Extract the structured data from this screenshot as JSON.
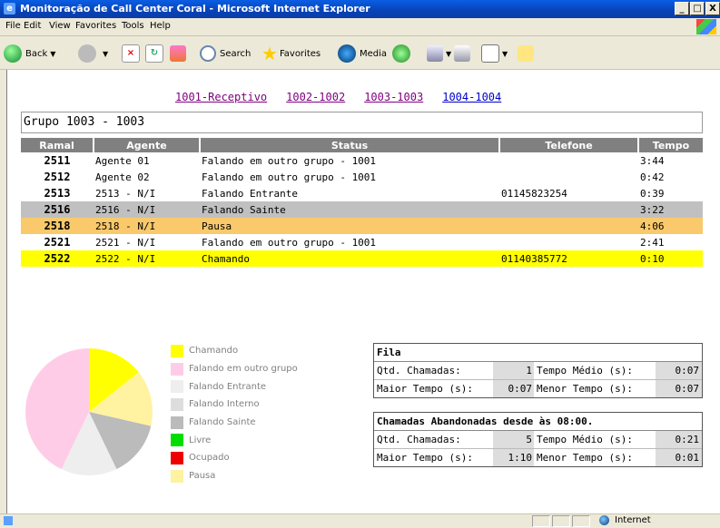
{
  "window": {
    "title": "Monitoração de Call Center Coral - Microsoft Internet Explorer",
    "controls": [
      "_",
      "□",
      "X"
    ]
  },
  "menu": [
    "File",
    "Edit",
    "View",
    "Favorites",
    "Tools",
    "Help"
  ],
  "toolbar": {
    "back": "Back",
    "search": "Search",
    "favorites": "Favorites",
    "media": "Media"
  },
  "links": [
    "1001-Receptivo",
    "1002-1002",
    "1003-1003",
    "1004-1004"
  ],
  "group_title": "Grupo 1003 - 1003",
  "table": {
    "headers": [
      "Ramal",
      "Agente",
      "Status",
      "Telefone",
      "Tempo"
    ],
    "rows": [
      {
        "ramal": "2511",
        "agente": "Agente 01",
        "status": "Falando em outro grupo - 1001",
        "telefone": "",
        "tempo": "3:44",
        "bg": "#ffffff"
      },
      {
        "ramal": "2512",
        "agente": "Agente 02",
        "status": "Falando em outro grupo - 1001",
        "telefone": "",
        "tempo": "0:42",
        "bg": "#ffffff"
      },
      {
        "ramal": "2513",
        "agente": "2513 - N/I",
        "status": "Falando Entrante",
        "telefone": "01145823254",
        "tempo": "0:39",
        "bg": "#ffffff"
      },
      {
        "ramal": "2516",
        "agente": "2516 - N/I",
        "status": "Falando Sainte",
        "telefone": "",
        "tempo": "3:22",
        "bg": "#c0c0c0"
      },
      {
        "ramal": "2518",
        "agente": "2518 - N/I",
        "status": "Pausa",
        "telefone": "",
        "tempo": "4:06",
        "bg": "#f9c96b"
      },
      {
        "ramal": "2521",
        "agente": "2521 - N/I",
        "status": "Falando em outro grupo - 1001",
        "telefone": "",
        "tempo": "2:41",
        "bg": "#ffffff"
      },
      {
        "ramal": "2522",
        "agente": "2522 - N/I",
        "status": "Chamando",
        "telefone": "01140385772",
        "tempo": "0:10",
        "bg": "#ffff00"
      }
    ]
  },
  "legend": [
    {
      "label": "Chamando",
      "color": "#ffff00"
    },
    {
      "label": "Falando em outro grupo",
      "color": "#ffcce8"
    },
    {
      "label": "Falando Entrante",
      "color": "#eeeeee"
    },
    {
      "label": "Falando Interno",
      "color": "#dddddd"
    },
    {
      "label": "Falando Sainte",
      "color": "#bbbbbb"
    },
    {
      "label": "Livre",
      "color": "#00dd00"
    },
    {
      "label": "Ocupado",
      "color": "#ee0000"
    },
    {
      "label": "Pausa",
      "color": "#fff2a0"
    }
  ],
  "chart_data": {
    "type": "pie",
    "categories": [
      "Chamando",
      "Falando em outro grupo",
      "Falando Entrante",
      "Falando Sainte",
      "Pausa"
    ],
    "values": [
      1,
      3,
      1,
      1,
      1
    ],
    "colors": [
      "#ffff00",
      "#ffcce8",
      "#eeeeee",
      "#bbbbbb",
      "#fff2a0"
    ]
  },
  "fila": {
    "title": "Fila",
    "qtd_label": "Qtd. Chamadas:",
    "qtd_value": "1",
    "tm_label": "Tempo Médio (s):",
    "tm_value": "0:07",
    "maior_label": "Maior Tempo (s):",
    "maior_value": "0:07",
    "menor_label": "Menor Tempo (s):",
    "menor_value": "0:07"
  },
  "abandonadas": {
    "title": "Chamadas Abandonadas desde às 08:00.",
    "qtd_label": "Qtd. Chamadas:",
    "qtd_value": "5",
    "tm_label": "Tempo Médio (s):",
    "tm_value": "0:21",
    "maior_label": "Maior Tempo (s):",
    "maior_value": "1:10",
    "menor_label": "Menor Tempo (s):",
    "menor_value": "0:01"
  },
  "status": {
    "zone": "Internet"
  }
}
